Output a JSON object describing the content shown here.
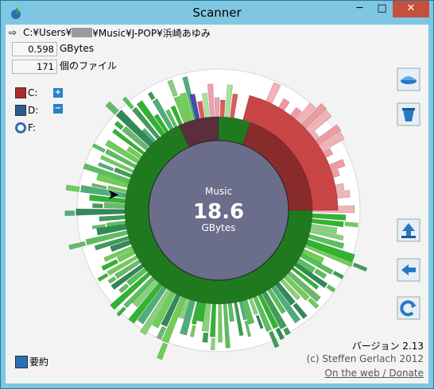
{
  "window": {
    "title": "Scanner"
  },
  "titlebar_buttons": {
    "minimize": "─",
    "maximize": "□",
    "close": "✕"
  },
  "path": {
    "prefix": "C:¥Users¥",
    "suffix": "¥Music¥J-POP¥浜崎あゆみ"
  },
  "info": {
    "size_value": "0.598",
    "size_unit": "GBytes",
    "file_count": "171",
    "file_label": "個のファイル"
  },
  "drives": [
    {
      "label": "C:"
    },
    {
      "label": "D:"
    },
    {
      "label": "F:"
    }
  ],
  "center": {
    "top": "Music",
    "value": "18.6",
    "unit": "GBytes"
  },
  "summary": {
    "label": "要約"
  },
  "credits": {
    "version": "バージョン 2.13",
    "copyright": "(c) Steffen Gerlach 2012",
    "link": "On the web / Donate"
  },
  "colors": {
    "inner_circle": "#6a6e8a",
    "ring_green": "#1f7a1f",
    "selected_dark": "#8a2b2b",
    "selected_bright": "#e35a5a",
    "disc": "#ffffff"
  }
}
